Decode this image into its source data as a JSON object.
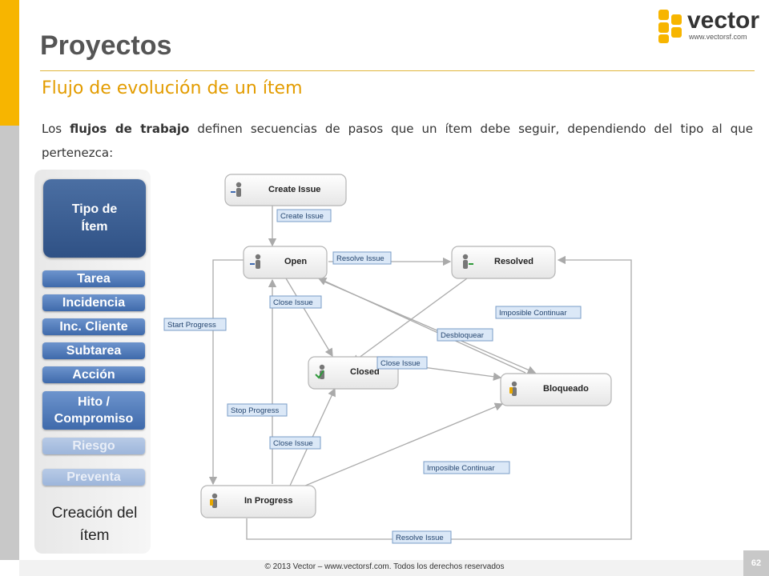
{
  "header": {
    "title": "Proyectos",
    "subtitle": "Flujo de evolución de un ítem",
    "intro_pre": "Los ",
    "intro_bold": "flujos de trabajo",
    "intro_post": " definen secuencias de pasos que un ítem debe seguir, dependiendo del tipo al que pertenezca:"
  },
  "logo": {
    "word": "vector",
    "url": "www.vectorsf.com"
  },
  "sidebar": {
    "type_box": "Tipo de Ítem",
    "items": [
      {
        "label": "Tarea"
      },
      {
        "label": "Incidencia"
      },
      {
        "label": "Inc. Cliente"
      },
      {
        "label": "Subtarea"
      },
      {
        "label": "Acción"
      },
      {
        "label": "Hito / Compromiso"
      },
      {
        "label": "Riesgo"
      },
      {
        "label": "Preventa"
      }
    ],
    "footer_label": "Creación del ítem"
  },
  "diagram": {
    "nodes": {
      "create": "Create Issue",
      "open": "Open",
      "resolved": "Resolved",
      "closed": "Closed",
      "bloqueado": "Bloqueado",
      "progress": "In Progress"
    },
    "transitions": {
      "create_issue": "Create Issue",
      "resolve_issue_1": "Resolve Issue",
      "close_issue_1": "Close Issue",
      "start_progress": "Start Progress",
      "imposible_1": "Imposible Continuar",
      "desbloquear": "Desbloquear",
      "close_issue_2": "Close Issue",
      "stop_progress": "Stop Progress",
      "close_issue_3": "Close Issue",
      "imposible_2": "Imposible Continuar",
      "resolve_issue_2": "Resolve Issue"
    }
  },
  "footer": {
    "text": "© 2013 Vector – www.vectorsf.com. Todos los derechos reservados",
    "page": "62"
  },
  "colors": {
    "accent": "#f7b500",
    "subtitle": "#e39c00",
    "button": "#4b74b3"
  }
}
